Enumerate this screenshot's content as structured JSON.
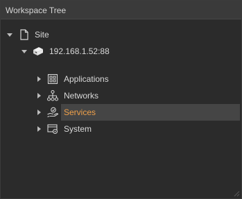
{
  "panel": {
    "title": "Workspace Tree"
  },
  "tree": {
    "root": {
      "label": "Site",
      "expanded": true,
      "icon": "document-icon"
    },
    "device": {
      "label": "192.168.1.52:88",
      "expanded": true,
      "icon": "device-icon"
    },
    "children": [
      {
        "label": "Applications",
        "icon": "applications-icon",
        "expanded": false,
        "selected": false
      },
      {
        "label": "Networks",
        "icon": "networks-icon",
        "expanded": false,
        "selected": false
      },
      {
        "label": "Services",
        "icon": "services-icon",
        "expanded": false,
        "selected": true
      },
      {
        "label": "System",
        "icon": "system-icon",
        "expanded": false,
        "selected": false
      }
    ]
  },
  "colors": {
    "background": "#2b2b2b",
    "header": "#3a3a3a",
    "text": "#d9d9d9",
    "selected_text": "#f0a14a",
    "selected_row": "#454545"
  }
}
